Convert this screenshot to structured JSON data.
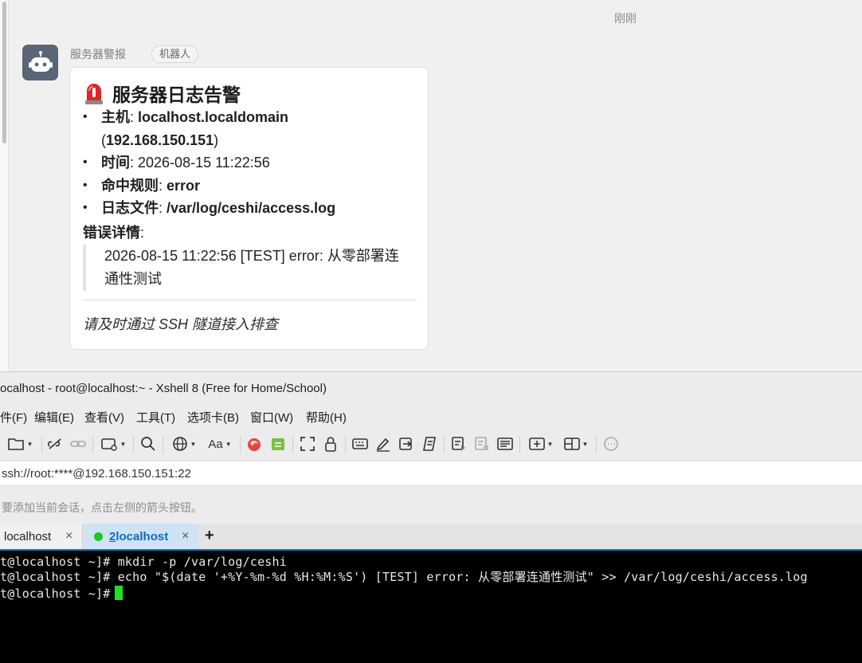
{
  "chat": {
    "timestamp": "刚刚",
    "sender_name": "服务器警报",
    "sender_tag": "机器人",
    "card": {
      "title": "服务器日志告警",
      "items": [
        {
          "key": "主机",
          "sep": ": ",
          "value": "localhost.localdomain",
          "extra_open": "(",
          "extra": "192.168.150.151",
          "extra_close": ")"
        },
        {
          "key": "时间",
          "sep": ": ",
          "value": "2026-08-15 11:22:56"
        },
        {
          "key": "命中规则",
          "sep": ": ",
          "value": "error"
        },
        {
          "key": "日志文件",
          "sep": ": ",
          "value": "/var/log/ceshi/access.log"
        }
      ],
      "detail_label": "错误详情",
      "detail_colon": ":",
      "detail_text": "2026-08-15 11:22:56 [TEST] error: 从零部署连通性测试",
      "footer": "请及时通过 SSH 隧道接入排查"
    }
  },
  "xshell": {
    "title": "ocalhost - root@localhost:~ - Xshell 8 (Free for Home/School)",
    "menu": [
      "件(F)",
      "编辑(E)",
      "查看(V)",
      "工具(T)",
      "选项卡(B)",
      "窗口(W)",
      "帮助(H)"
    ],
    "toolbar_icons": [
      "folder-icon",
      "disconnect-icon",
      "link-icon",
      "new-window-icon",
      "search-icon",
      "globe-icon",
      "font-icon",
      "xftp-icon",
      "xftp-green-icon",
      "fullscreen-icon",
      "lock-icon",
      "keyboard-icon",
      "pen-icon",
      "send-icon",
      "script-icon",
      "log-start-icon",
      "log-stop-icon",
      "log-view-icon",
      "new-tab-icon",
      "layout-icon",
      "chat-icon"
    ],
    "font_label": "Aa",
    "address_value": "ssh://root:****@192.168.150.151:22",
    "hint": "要添加当前会话，点击左侧的箭头按钮。",
    "tabs": [
      {
        "label": "localhost",
        "close": "×"
      },
      {
        "num": "2",
        "label": " localhost",
        "close": "×"
      }
    ],
    "tab_add": "+",
    "terminal_lines": [
      "t@localhost ~]# mkdir -p /var/log/ceshi",
      "t@localhost ~]# echo \"$(date '+%Y-%m-%d %H:%M:%S') [TEST] error: 从零部署连通性测试\" >> /var/log/ceshi/access.log",
      "t@localhost ~]#"
    ]
  },
  "colors": {
    "accent_blue": "#0a7ad6",
    "cursor_green": "#22e022",
    "tab_active_bg": "#cfe3f5",
    "terminal_bg": "#000000"
  }
}
